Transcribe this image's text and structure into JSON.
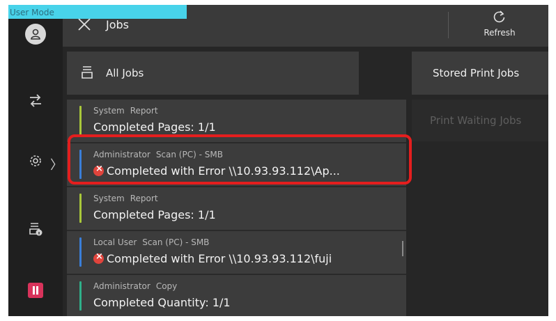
{
  "user_mode_label": "User Mode",
  "header": {
    "title": "Jobs",
    "refresh_label": "Refresh"
  },
  "list": {
    "all_jobs_label": "All Jobs"
  },
  "jobs": [
    {
      "owner": "System",
      "type": "Report",
      "status": "Completed  Pages: 1/1",
      "error": false,
      "bar_color": "#a9c83a"
    },
    {
      "owner": "Administrator",
      "type": "Scan (PC) - SMB",
      "status": "Completed with Error  \\\\10.93.93.112\\Ap...",
      "error": true,
      "bar_color": "#3a7ed8"
    },
    {
      "owner": "System",
      "type": "Report",
      "status": "Completed  Pages: 1/1",
      "error": false,
      "bar_color": "#a9c83a"
    },
    {
      "owner": "Local User",
      "type": "Scan (PC) - SMB",
      "status": "Completed with Error  \\\\10.93.93.112\\fuji",
      "error": true,
      "bar_color": "#3a7ed8"
    },
    {
      "owner": "Administrator",
      "type": "Copy",
      "status": "Completed  Quantity: 1/1",
      "error": false,
      "bar_color": "#2fb08a"
    }
  ],
  "right_panel": {
    "stored_label": "Stored Print Jobs",
    "waiting_label": "Print Waiting Jobs"
  },
  "colors": {
    "accent_highlight": "#e41e1e",
    "user_mode_tag": "#48d3ea",
    "pause": "#d8335b",
    "error": "#e0443c"
  },
  "icons": [
    "user-icon",
    "job-flow-icon",
    "gear-icon",
    "printer-info-icon",
    "pause-icon",
    "close-icon",
    "refresh-icon",
    "all-jobs-icon",
    "error-icon"
  ]
}
